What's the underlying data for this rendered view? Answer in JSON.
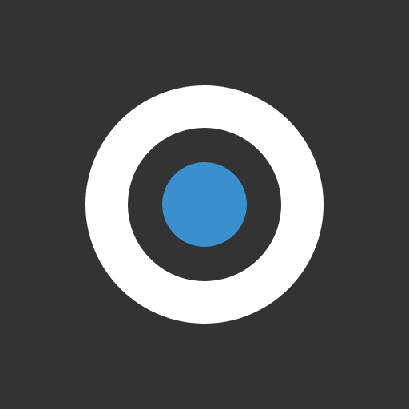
{
  "icon": {
    "name": "radio-selected-icon",
    "state": "selected"
  },
  "colors": {
    "background": "#333333",
    "ring": "#ffffff",
    "dot": "#3a90cd"
  }
}
